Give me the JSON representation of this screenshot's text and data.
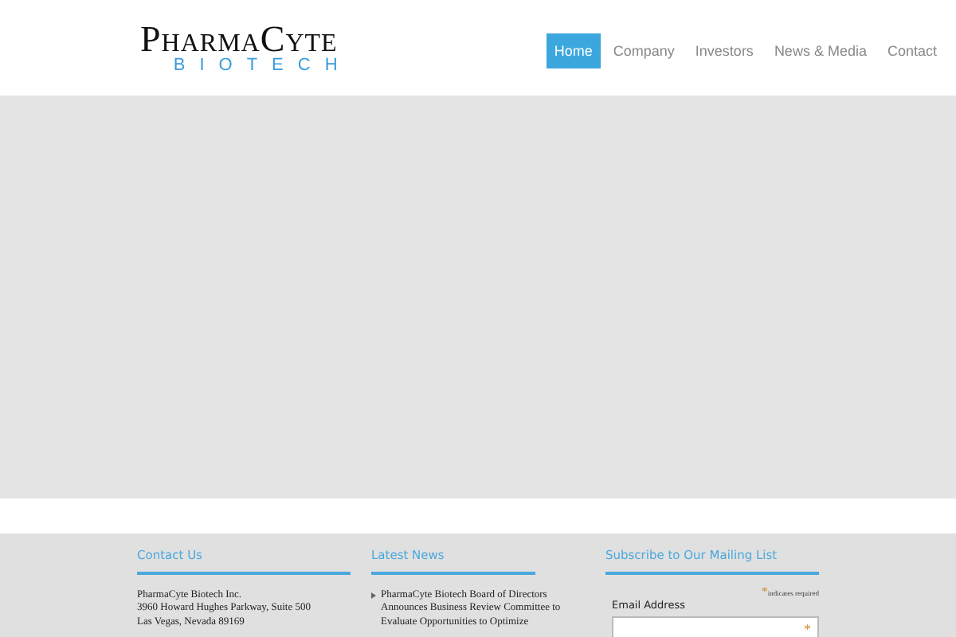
{
  "logo": {
    "name": "PharmaCyte",
    "tagline": "BIOTECH"
  },
  "nav": [
    {
      "label": "Home",
      "selected": true
    },
    {
      "label": "Company",
      "selected": false
    },
    {
      "label": "Investors",
      "selected": false
    },
    {
      "label": "News & Media",
      "selected": false
    },
    {
      "label": "Contact",
      "selected": false
    }
  ],
  "contact": {
    "title": "Contact Us",
    "lines": [
      "PharmaCyte Biotech Inc.",
      "3960 Howard Hughes Parkway, Suite 500",
      "Las Vegas, Nevada 89169"
    ]
  },
  "news": {
    "title": "Latest News",
    "items": [
      "PharmaCyte Biotech Board of Directors Announces Business Review Committee to Evaluate Opportunities to Optimize"
    ]
  },
  "subscribe": {
    "title": "Subscribe to Our Mailing List",
    "required_mark": "*",
    "required_note": "indicates required",
    "field_label": "Email Address"
  }
}
